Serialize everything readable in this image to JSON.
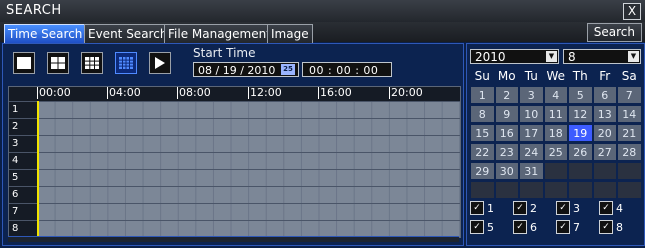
{
  "window": {
    "title": "SEARCH",
    "close_glyph": "X"
  },
  "tabs": [
    {
      "label": "Time Search",
      "active": true
    },
    {
      "label": "Event Search",
      "active": false
    },
    {
      "label": "File Management",
      "active": false
    },
    {
      "label": "Image",
      "active": false
    }
  ],
  "search_button": "Search",
  "view_buttons": [
    "single-view-icon",
    "quad-view-icon",
    "nine-view-icon",
    "sixteen-view-icon",
    "play-icon"
  ],
  "start_time": {
    "label": "Start Time",
    "date": "08 / 19 / 2010",
    "spin_text": "25",
    "time": "00 :  00 :  00"
  },
  "timeline": {
    "labels": [
      "00:00",
      "04:00",
      "08:00",
      "12:00",
      "16:00",
      "20:00"
    ],
    "rows": [
      "1",
      "2",
      "3",
      "4",
      "5",
      "6",
      "7",
      "8"
    ]
  },
  "calendar": {
    "year": "2010",
    "month": "8",
    "weekdays": [
      "Su",
      "Mo",
      "Tu",
      "We",
      "Th",
      "Fr",
      "Sa"
    ],
    "weeks": [
      [
        "1",
        "2",
        "3",
        "4",
        "5",
        "6",
        "7"
      ],
      [
        "8",
        "9",
        "10",
        "11",
        "12",
        "13",
        "14"
      ],
      [
        "15",
        "16",
        "17",
        "18",
        "19",
        "20",
        "21"
      ],
      [
        "22",
        "23",
        "24",
        "25",
        "26",
        "27",
        "28"
      ],
      [
        "29",
        "30",
        "31",
        "",
        "",
        "",
        ""
      ],
      [
        "",
        "",
        "",
        "",
        "",
        "",
        ""
      ]
    ],
    "selected_day": "19"
  },
  "channels": [
    {
      "label": "1",
      "checked": true
    },
    {
      "label": "2",
      "checked": true
    },
    {
      "label": "3",
      "checked": true
    },
    {
      "label": "4",
      "checked": true
    },
    {
      "label": "5",
      "checked": true
    },
    {
      "label": "6",
      "checked": true
    },
    {
      "label": "7",
      "checked": true
    },
    {
      "label": "8",
      "checked": true
    }
  ],
  "colors": {
    "accent": "#3d5cff",
    "cursor": "#f2e400",
    "background": "#0b1f47"
  }
}
